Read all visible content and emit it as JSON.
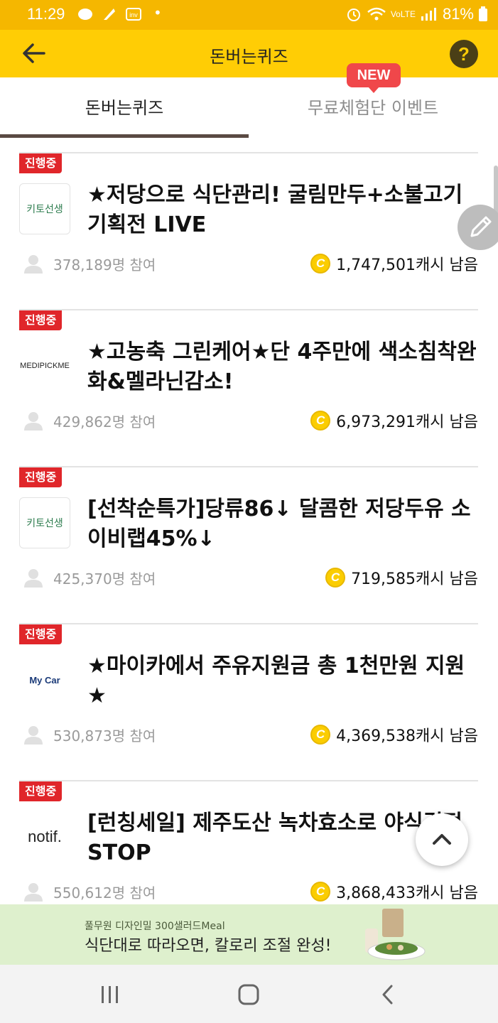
{
  "status_bar": {
    "time": "11:29",
    "dot": "•",
    "network": "VoLTE",
    "battery": "81%"
  },
  "appbar": {
    "title": "돈버는퀴즈"
  },
  "tabs": [
    {
      "label": "돈버는퀴즈",
      "active": true
    },
    {
      "label": "무료체험단 이벤트",
      "active": false,
      "badge": "NEW"
    }
  ],
  "quiz_items": [
    {
      "status": "진행중",
      "logo": "키토선생",
      "title": "★저당으로 식단관리! 굴림만두+소불고기 기획전 LIVE",
      "participants": "378,189명 참여",
      "cash": "1,747,501캐시 남음"
    },
    {
      "status": "진행중",
      "logo": "MEDIPICKME",
      "title": "★고농축 그린케어★단 4주만에 색소침착완화&멜라닌감소!",
      "participants": "429,862명 참여",
      "cash": "6,973,291캐시 남음"
    },
    {
      "status": "진행중",
      "logo": "키토선생",
      "title": "[선착순특가]당류86↓ 달콤한 저당두유 소이비랩45%↓",
      "participants": "425,370명 참여",
      "cash": "719,585캐시 남음"
    },
    {
      "status": "진행중",
      "logo": "My Car",
      "title": "★마이카에서 주유지원금 총 1천만원 지원★",
      "participants": "530,873명 참여",
      "cash": "4,369,538캐시 남음"
    },
    {
      "status": "진행중",
      "logo": "notif.",
      "title": "[런칭세일] 제주도산 녹차효소로 야식걱정 STOP",
      "participants": "550,612명 참여",
      "cash": "3,868,433캐시 남음"
    }
  ],
  "coin_glyph": "C",
  "ad": {
    "brand": "풀무원 디자인밀 300샐러드Meal",
    "text": "식단대로 따라오면, 칼로리 조절 완성!"
  },
  "icons": {
    "back": "arrow-left-icon",
    "help": "question-icon",
    "edit": "pencil-icon",
    "top": "chevron-up-icon",
    "person": "person-icon",
    "coin": "coin-icon"
  },
  "colors": {
    "brand_yellow": "#ffcd05",
    "status_red": "#e0262a",
    "new_badge": "#f0474a"
  }
}
